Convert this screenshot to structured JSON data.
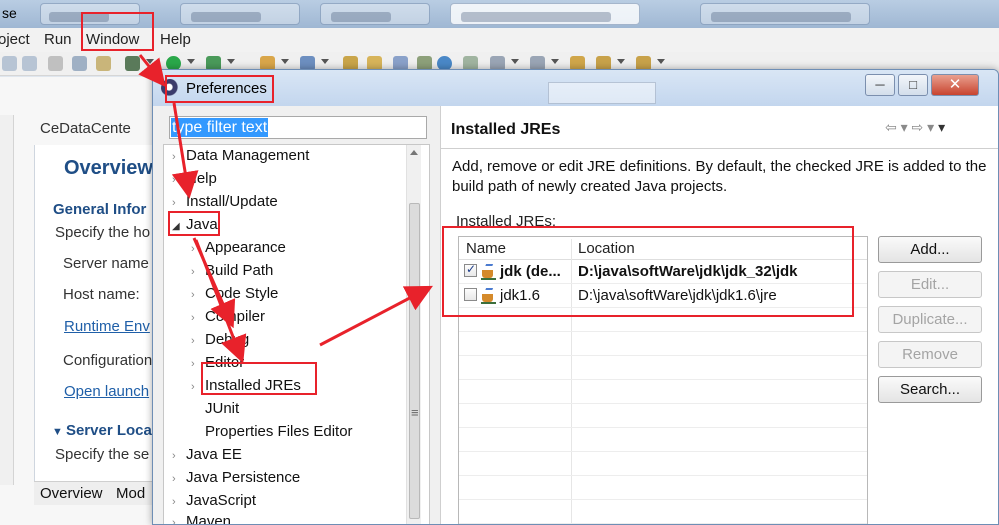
{
  "window": {
    "title_fragment": "se",
    "menu": [
      "oject",
      "Run",
      "Window",
      "Help"
    ]
  },
  "background_editor": {
    "tab_label": "CeDataCente",
    "heading": "Overview",
    "section1": "General Infor",
    "section1_desc": "Specify the ho",
    "fields": [
      "Server name",
      "Host name:"
    ],
    "link1": "Runtime Env",
    "config_label": "Configuration",
    "link2": "Open launch",
    "section2": "Server Loca",
    "section2_desc": "Specify the se",
    "bottom_tabs": [
      "Overview",
      "Mod"
    ]
  },
  "dialog": {
    "title": "Preferences",
    "window_buttons": {
      "minimize": "─",
      "maximize": "□",
      "close": "✕"
    },
    "filter_text": "type filter text",
    "tree": [
      {
        "label": "Data Management",
        "level": 0,
        "state": "collapsed"
      },
      {
        "label": "Help",
        "level": 0,
        "state": "collapsed"
      },
      {
        "label": "Install/Update",
        "level": 0,
        "state": "collapsed"
      },
      {
        "label": "Java",
        "level": 0,
        "state": "expanded"
      },
      {
        "label": "Appearance",
        "level": 1,
        "state": "collapsed"
      },
      {
        "label": "Build Path",
        "level": 1,
        "state": "collapsed"
      },
      {
        "label": "Code Style",
        "level": 1,
        "state": "collapsed"
      },
      {
        "label": "Compiler",
        "level": 1,
        "state": "collapsed"
      },
      {
        "label": "Debug",
        "level": 1,
        "state": "collapsed"
      },
      {
        "label": "Editor",
        "level": 1,
        "state": "collapsed"
      },
      {
        "label": "Installed JREs",
        "level": 1,
        "state": "collapsed"
      },
      {
        "label": "JUnit",
        "level": 1,
        "state": "leaf"
      },
      {
        "label": "Properties Files Editor",
        "level": 1,
        "state": "leaf"
      },
      {
        "label": "Java EE",
        "level": 0,
        "state": "collapsed"
      },
      {
        "label": "Java Persistence",
        "level": 0,
        "state": "collapsed"
      },
      {
        "label": "JavaScript",
        "level": 0,
        "state": "collapsed"
      },
      {
        "label": "Maven",
        "level": 0,
        "state": "collapsed"
      }
    ],
    "page": {
      "title": "Installed JREs",
      "description": "Add, remove or edit JRE definitions. By default, the checked JRE is added to the build path of newly created Java projects.",
      "table_label": "Installed JREs:",
      "columns": [
        "Name",
        "Location"
      ],
      "rows": [
        {
          "checked": true,
          "name": "jdk (de...",
          "location": "D:\\java\\softWare\\jdk\\jdk_32\\jdk",
          "bold": true
        },
        {
          "checked": false,
          "name": "jdk1.6",
          "location": "D:\\java\\softWare\\jdk\\jdk1.6\\jre",
          "bold": false
        }
      ],
      "buttons": [
        {
          "label": "Add...",
          "enabled": true
        },
        {
          "label": "Edit...",
          "enabled": false
        },
        {
          "label": "Duplicate...",
          "enabled": false
        },
        {
          "label": "Remove",
          "enabled": false
        },
        {
          "label": "Search...",
          "enabled": true
        }
      ]
    }
  },
  "colors": {
    "annotation_red": "#e8222b",
    "selection_blue": "#3399ff",
    "link_blue": "#1f5fa8"
  }
}
